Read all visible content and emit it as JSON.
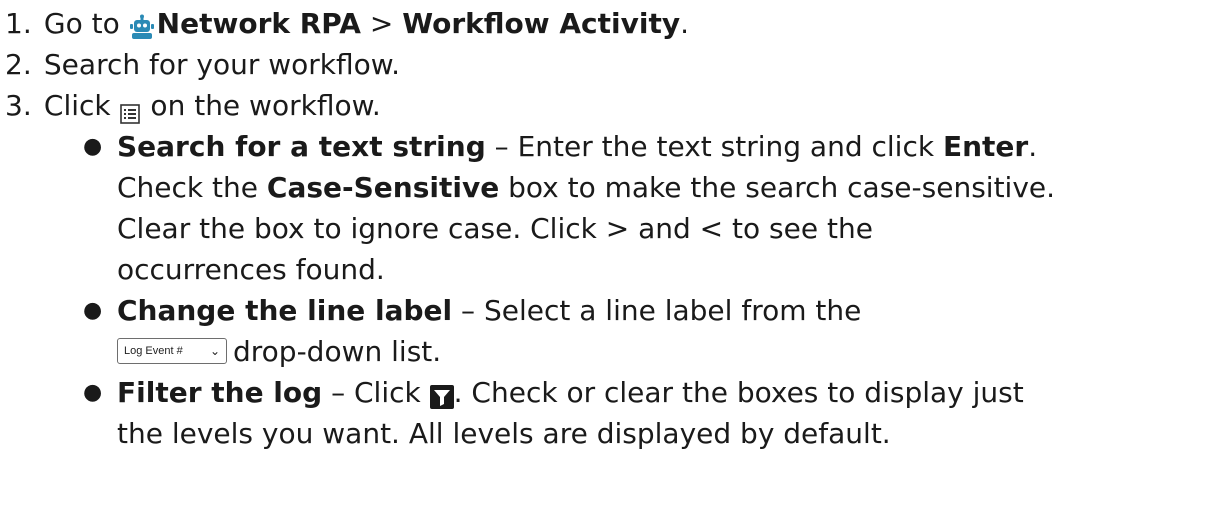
{
  "steps": [
    {
      "number": "1.",
      "text_before": "Go to ",
      "bold1": "Network RPA",
      "separator": " > ",
      "bold2": "Workflow Activity",
      "text_after": "."
    },
    {
      "number": "2.",
      "text": "Search for your workflow."
    },
    {
      "number": "3.",
      "text_before": "Click ",
      "text_after": " on the workflow."
    }
  ],
  "bullets": {
    "search": {
      "title": "Search for a text string",
      "dash": " – ",
      "text1": "Enter the text string and click ",
      "bold_enter": "Enter",
      "period": ".",
      "line2_before": "Check the ",
      "bold_case": "Case-Sensitive",
      "line2_after": " box to make the search case-sensitive.",
      "line3": "Clear the box to ignore case. Click > and < to see the",
      "line4": "occurrences found."
    },
    "label": {
      "title": "Change the line label",
      "dash": " – ",
      "text1": "Select a line label from the",
      "select_value": "Log Event #",
      "text2": "drop-down list."
    },
    "filter": {
      "title": "Filter the log",
      "dash": " – ",
      "text1": "Click ",
      "text2": ". Check or clear the boxes to display just",
      "line2": "the levels you want. All levels are displayed by default."
    }
  },
  "icons": {
    "robot": "robot-icon",
    "list": "list-icon",
    "filter": "filter-icon",
    "select_chevron": "chevron-down-icon"
  },
  "colors": {
    "robot_icon": "#2a8ab5",
    "filter_icon_bg": "#1a1a1a"
  }
}
